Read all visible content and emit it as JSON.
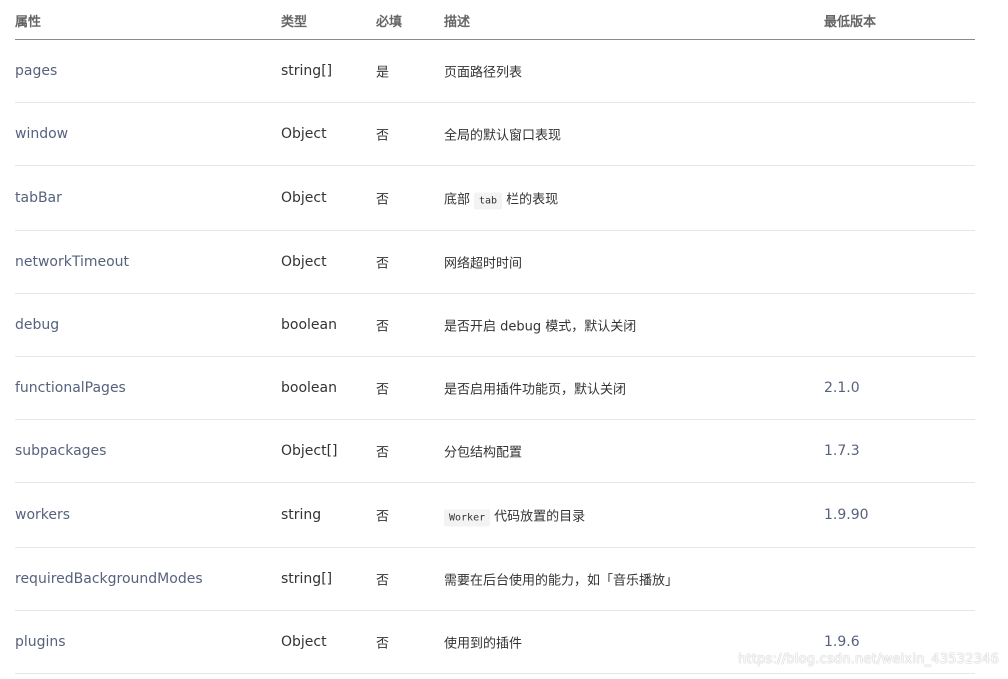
{
  "headers": {
    "attr": "属性",
    "type": "类型",
    "required": "必填",
    "desc": "描述",
    "min_version": "最低版本"
  },
  "rows": [
    {
      "attr": "pages",
      "type": "string[]",
      "required": "是",
      "desc": "页面路径列表",
      "min_version": ""
    },
    {
      "attr": "window",
      "type": "Object",
      "required": "否",
      "desc": "全局的默认窗口表现",
      "min_version": ""
    },
    {
      "attr": "tabBar",
      "type": "Object",
      "required": "否",
      "desc_pre": "底部",
      "desc_code": "tab",
      "desc_post": "栏的表现",
      "min_version": ""
    },
    {
      "attr": "networkTimeout",
      "type": "Object",
      "required": "否",
      "desc": "网络超时时间",
      "min_version": ""
    },
    {
      "attr": "debug",
      "type": "boolean",
      "required": "否",
      "desc": "是否开启 debug 模式，默认关闭",
      "min_version": ""
    },
    {
      "attr": "functionalPages",
      "type": "boolean",
      "required": "否",
      "desc": "是否启用插件功能页，默认关闭",
      "min_version": "2.1.0"
    },
    {
      "attr": "subpackages",
      "type": "Object[]",
      "required": "否",
      "desc": "分包结构配置",
      "min_version": "1.7.3"
    },
    {
      "attr": "workers",
      "type": "string",
      "required": "否",
      "desc_code": "Worker",
      "desc_post": "代码放置的目录",
      "min_version": "1.9.90"
    },
    {
      "attr": "requiredBackgroundModes",
      "type": "string[]",
      "required": "否",
      "desc": "需要在后台使用的能力，如「音乐播放」",
      "min_version": ""
    },
    {
      "attr": "plugins",
      "type": "Object",
      "required": "否",
      "desc": "使用到的插件",
      "min_version": "1.9.6"
    }
  ],
  "watermark": "https://blog.csdn.net/weixin_43532346"
}
